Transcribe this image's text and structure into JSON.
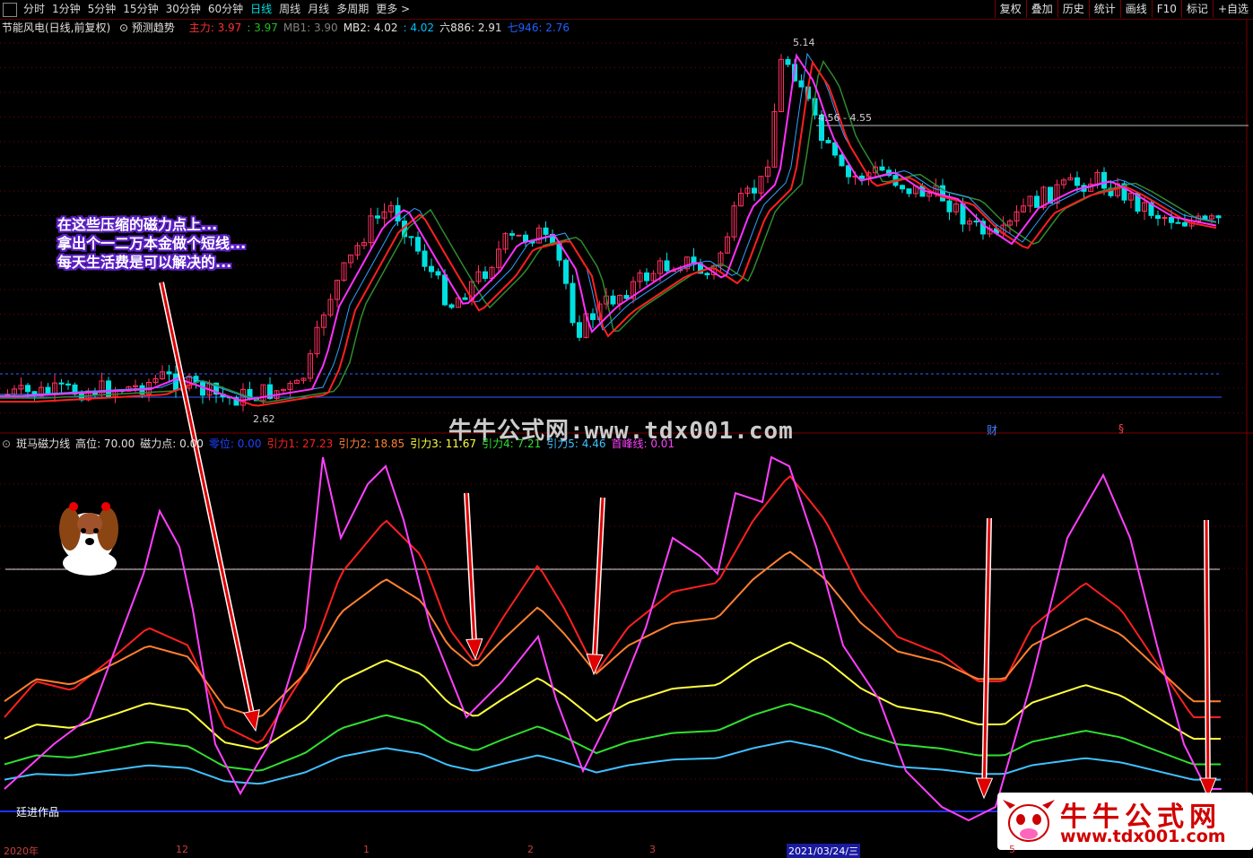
{
  "toolbar": {
    "tabs": [
      "分时",
      "1分钟",
      "5分钟",
      "15分钟",
      "30分钟",
      "60分钟",
      "日线",
      "周线",
      "月线",
      "多周期",
      "更多 >"
    ],
    "active_tab": "日线",
    "right_buttons": [
      "复权",
      "叠加",
      "历史",
      "统计",
      "画线",
      "F10",
      "标记",
      "+自选"
    ]
  },
  "main_legend": {
    "stock": "节能风电(日线,前复权)",
    "predict": "预测趋势",
    "items": [
      {
        "label": "主力: 3.97",
        "color": "#ff3030"
      },
      {
        "label": ": 3.97",
        "color": "#20c020"
      },
      {
        "label": "MB1: 3.90",
        "color": "#808080"
      },
      {
        "label": "MB2: 4.02",
        "color": "#e0e0e0"
      },
      {
        "label": ": 4.02",
        "color": "#00c0ff"
      },
      {
        "label": "六886: 2.91",
        "color": "#e0e0e0"
      },
      {
        "label": "七946: 2.76",
        "color": "#2060ff"
      }
    ]
  },
  "price_labels": {
    "high": "5.14",
    "range": "4.56 - 4.55",
    "low": "2.62"
  },
  "annotation": {
    "lines": [
      "在这些压缩的磁力点上...",
      "拿出个一二万本金做个短线...",
      "每天生活费是可以解决的..."
    ]
  },
  "watermark": "牛牛公式网:www.tdx001.com",
  "markers": {
    "cai": "财",
    "s": "§"
  },
  "indicator_legend": {
    "items": [
      {
        "label": "斑马磁力线",
        "color": "#e0e0e0"
      },
      {
        "label": "高位: 70.00",
        "color": "#e0e0e0"
      },
      {
        "label": "磁力点: 0.00",
        "color": "#e0e0e0"
      },
      {
        "label": "零位: 0.00",
        "color": "#2040ff"
      },
      {
        "label": "引力1: 27.23",
        "color": "#ff2020"
      },
      {
        "label": "引力2: 18.85",
        "color": "#ff8030"
      },
      {
        "label": "引力3: 11.67",
        "color": "#ffff40"
      },
      {
        "label": "引力4: 7.21",
        "color": "#30e030"
      },
      {
        "label": "引力5: 4.46",
        "color": "#40c0ff"
      },
      {
        "label": "首峰线: 0.01",
        "color": "#ff40ff"
      }
    ]
  },
  "author": "廷进作品",
  "logo": {
    "title": "牛牛公式网",
    "url": "www.tdx001.com"
  },
  "xaxis": {
    "labels": [
      "2020年",
      "12",
      "1",
      "2",
      "3",
      "2021/03/24/三",
      "5"
    ]
  },
  "colors": {
    "up": "#ff3060",
    "down": "#00e0e0",
    "grid": "#7a0000"
  }
}
